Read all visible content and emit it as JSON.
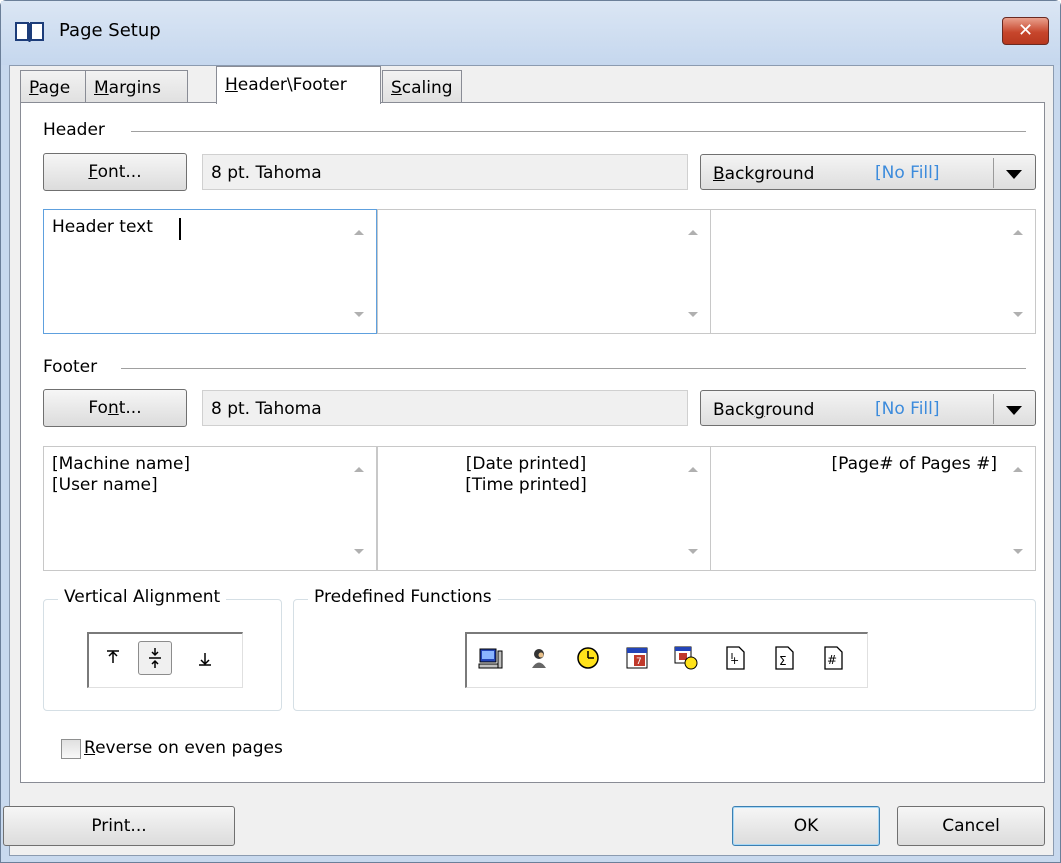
{
  "window": {
    "title": "Page Setup",
    "close_label": "✕"
  },
  "tabs": [
    {
      "label": "Page",
      "mnemonic": "P",
      "rest": "age"
    },
    {
      "label": "Margins",
      "mnemonic": "M",
      "rest": "argins"
    },
    {
      "label": "Header\\Footer",
      "mnemonic": "H",
      "rest": "eader\\Footer",
      "active": true
    },
    {
      "label": "Scaling",
      "mnemonic": "S",
      "rest": "caling"
    }
  ],
  "header": {
    "title": "Header",
    "font_button": {
      "mnemonic": "F",
      "rest": "ont..."
    },
    "font_value": "8 pt. Tahoma",
    "background": {
      "label_m": "B",
      "label_rest": "ackground",
      "fill": "[No Fill]"
    },
    "left_text": "Header text",
    "center_text": "",
    "right_text": ""
  },
  "footer": {
    "title": "Footer",
    "font_button": {
      "pre": "Fo",
      "mnemonic": "n",
      "rest": "t..."
    },
    "font_value": "8 pt. Tahoma",
    "background": {
      "pre": "Back",
      "label_m": "g",
      "label_rest": "round",
      "fill": "[No Fill]"
    },
    "left_text": "[Machine name]\n[User name]",
    "center_text": "[Date printed]\n[Time printed]",
    "right_text": "[Page# of Pages #]"
  },
  "vertical_alignment": {
    "title": "Vertical Alignment",
    "buttons": [
      "align-top-icon",
      "align-center-icon",
      "align-bottom-icon"
    ],
    "selected": "align-center-icon"
  },
  "predefined_functions": {
    "title": "Predefined Functions",
    "buttons": [
      "machine-name-icon",
      "user-name-icon",
      "time-printed-icon",
      "date-printed-icon",
      "date-time-icon",
      "page-number-icon",
      "total-pages-icon",
      "page-of-pages-icon"
    ]
  },
  "reverse_checkbox": {
    "mnemonic": "R",
    "rest": "everse on even pages",
    "checked": false
  },
  "buttons": {
    "print": "Print...",
    "ok": "OK",
    "cancel": "Cancel"
  },
  "colors": {
    "accent": "#3c8bdc",
    "window_frame": "#c8d9ee",
    "close": "#c7462c"
  }
}
